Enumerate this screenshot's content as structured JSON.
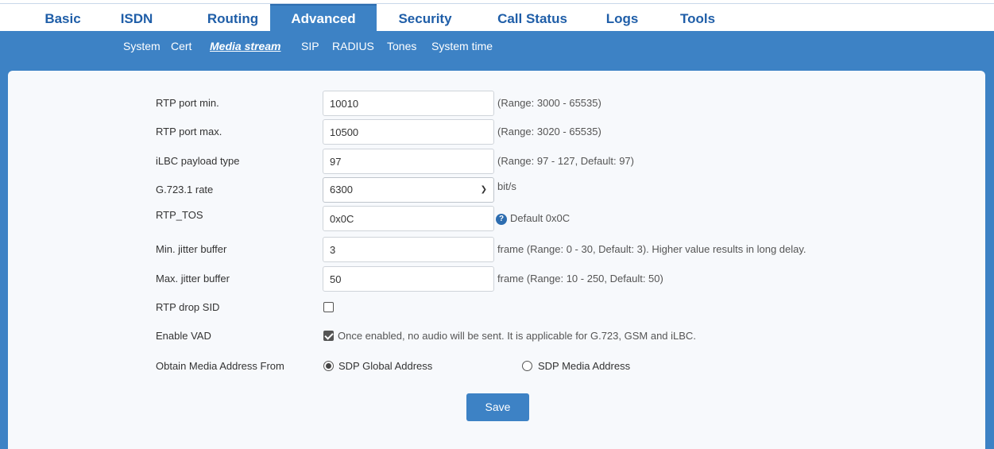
{
  "main_tabs": [
    {
      "label": "Basic"
    },
    {
      "label": "ISDN"
    },
    {
      "label": "Routing"
    },
    {
      "label": "Advanced"
    },
    {
      "label": "Security"
    },
    {
      "label": "Call Status"
    },
    {
      "label": "Logs"
    },
    {
      "label": "Tools"
    }
  ],
  "sub_tabs": [
    {
      "label": "System"
    },
    {
      "label": "Cert"
    },
    {
      "label": "Media stream"
    },
    {
      "label": "SIP"
    },
    {
      "label": "RADIUS"
    },
    {
      "label": "Tones"
    },
    {
      "label": "System time"
    }
  ],
  "active_main_tab": "Advanced",
  "active_sub_tab": "Media stream",
  "form": {
    "rtp_port_min": {
      "label": "RTP port min.",
      "value": "10010",
      "hint": "(Range: 3000 - 65535)"
    },
    "rtp_port_max": {
      "label": "RTP port max.",
      "value": "10500",
      "hint": "(Range: 3020 - 65535)"
    },
    "ilbc_payload": {
      "label": "iLBC payload type",
      "value": "97",
      "hint": "(Range: 97 - 127, Default: 97)"
    },
    "g7231_rate": {
      "label": "G.723.1 rate",
      "value": "6300",
      "hint": "bit/s"
    },
    "rtp_tos": {
      "label": "RTP_TOS",
      "value": "0x0C",
      "hint": "Default 0x0C"
    },
    "min_jitter": {
      "label": "Min. jitter buffer",
      "value": "3",
      "hint": "frame (Range: 0 - 30, Default: 3). Higher value results in long delay."
    },
    "max_jitter": {
      "label": "Max. jitter buffer",
      "value": "50",
      "hint": "frame (Range: 10 - 250, Default: 50)"
    },
    "rtp_drop_sid": {
      "label": "RTP drop SID",
      "checked": false
    },
    "enable_vad": {
      "label": "Enable VAD",
      "checked": true,
      "text": "Once enabled, no audio will be sent. It is applicable for G.723, GSM and iLBC."
    },
    "media_address": {
      "label": "Obtain Media Address From",
      "options": [
        {
          "label": "SDP Global Address",
          "selected": true
        },
        {
          "label": "SDP Media Address",
          "selected": false
        }
      ]
    }
  },
  "save_label": "Save",
  "colors": {
    "accent": "#3d82c5",
    "tab_text": "#1f5ea8",
    "panel_bg": "#f7f9fc"
  },
  "icons": {
    "select_chevron": "chevron-down-icon",
    "help": "help-circle-icon"
  }
}
